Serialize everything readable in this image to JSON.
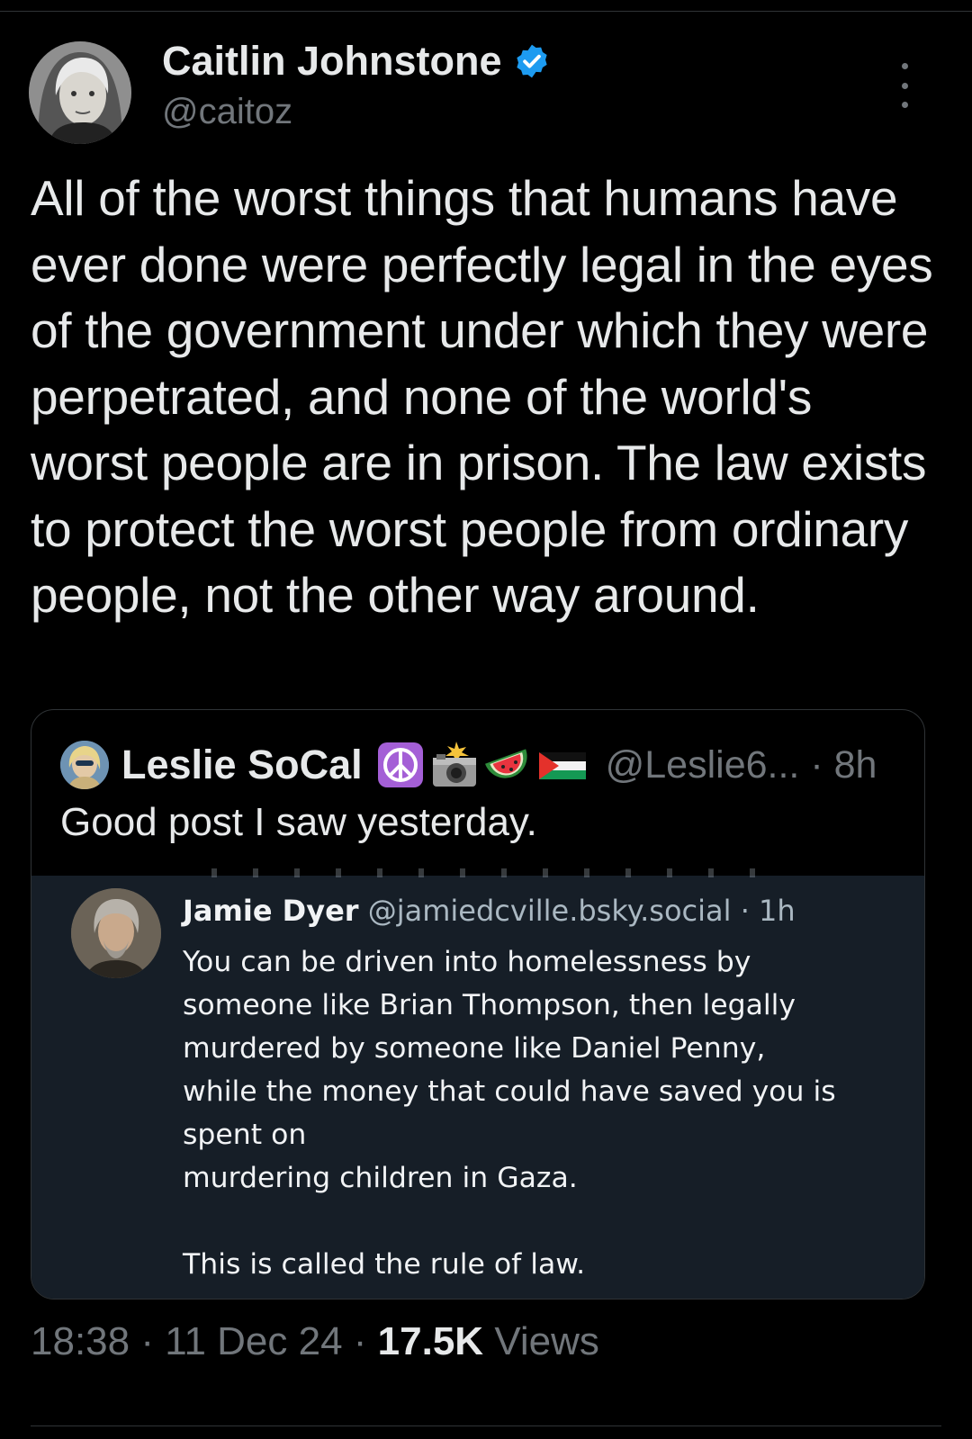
{
  "author": {
    "name": "Caitlin Johnstone",
    "handle": "@caitoz",
    "verified": true
  },
  "tweet": {
    "text": "All of the worst things that humans have ever done were perfectly legal in the eyes of the government under which they were perpetrated, and none of the world's worst people are in prison. The law exists to protect the worst people from ordinary people, not the other way around."
  },
  "quote": {
    "name": "Leslie SoCal",
    "emojis": [
      "peace-symbol",
      "camera-with-flash",
      "watermelon",
      "palestine-flag"
    ],
    "handle": "@Leslie6...",
    "separator": "·",
    "time": "8h",
    "text": "Good post I saw yesterday.",
    "embedded_post": {
      "name": "Jamie Dyer",
      "handle": "@jamiedcville.bsky.social",
      "separator": "·",
      "time": "1h",
      "lines": [
        "You can be driven into homelessness by",
        "someone like Brian Thompson, then legally",
        "murdered by someone like Daniel Penny,",
        "while the money that could have saved you is",
        "spent on",
        "murdering children in Gaza.",
        "",
        "This is called the rule of law."
      ]
    }
  },
  "footer": {
    "time": "18:38",
    "date": "11 Dec 24",
    "views_count": "17.5K",
    "views_label": "Views",
    "separator": "·"
  },
  "colors": {
    "background": "#000000",
    "text_primary": "#e7e9ea",
    "text_secondary": "#71767b",
    "verified_blue": "#1d9bf0",
    "border": "#2f3336",
    "embed_background": "#161e27"
  }
}
